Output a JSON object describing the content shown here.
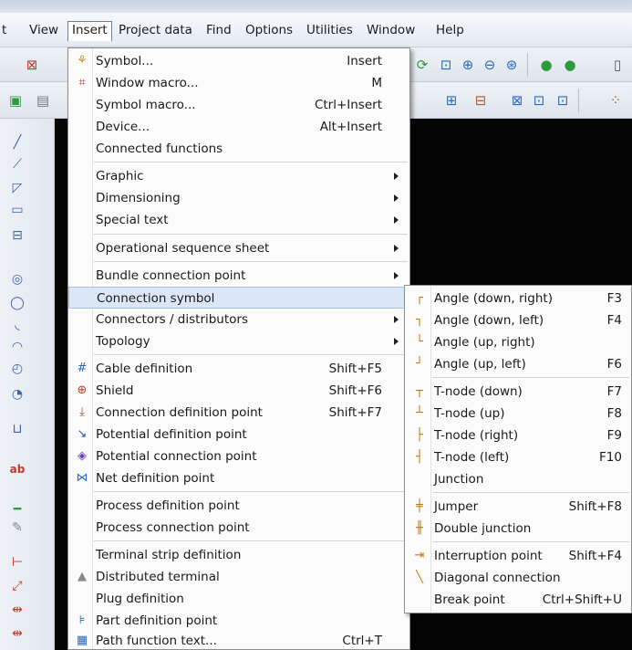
{
  "menubar": {
    "items": [
      "t",
      "View",
      "Insert",
      "Project data",
      "Find",
      "Options",
      "Utilities",
      "Window",
      "Help"
    ]
  },
  "insert_menu": {
    "items": [
      {
        "label": "Symbol...",
        "shortcut": "Insert",
        "icon": "symbol-icon"
      },
      {
        "label": "Window macro...",
        "shortcut": "M",
        "icon": "window-macro-icon"
      },
      {
        "label": "Symbol macro...",
        "shortcut": "Ctrl+Insert"
      },
      {
        "label": "Device...",
        "shortcut": "Alt+Insert"
      },
      {
        "label": "Connected functions"
      },
      {
        "label": "Graphic",
        "submenu": true
      },
      {
        "label": "Dimensioning",
        "submenu": true
      },
      {
        "label": "Special text",
        "submenu": true
      },
      {
        "label": "Operational sequence sheet",
        "submenu": true
      },
      {
        "label": "Bundle connection point",
        "submenu": true
      },
      {
        "label": "Connection symbol",
        "submenu": true,
        "highlighted": true
      },
      {
        "label": "Connectors / distributors",
        "submenu": true
      },
      {
        "label": "Topology",
        "submenu": true
      },
      {
        "label": "Cable definition",
        "shortcut": "Shift+F5",
        "icon": "cable-definition-icon"
      },
      {
        "label": "Shield",
        "shortcut": "Shift+F6",
        "icon": "shield-icon"
      },
      {
        "label": "Connection definition point",
        "shortcut": "Shift+F7",
        "icon": "connection-definition-point-icon"
      },
      {
        "label": "Potential definition point",
        "icon": "potential-definition-point-icon"
      },
      {
        "label": "Potential connection point",
        "icon": "potential-connection-point-icon"
      },
      {
        "label": "Net definition point",
        "icon": "net-definition-point-icon"
      },
      {
        "label": "Process definition point"
      },
      {
        "label": "Process connection point"
      },
      {
        "label": "Terminal strip definition"
      },
      {
        "label": "Distributed terminal",
        "icon": "distributed-terminal-icon"
      },
      {
        "label": "Plug definition"
      },
      {
        "label": "Part definition point",
        "icon": "part-definition-point-icon"
      },
      {
        "label": "Path function text...",
        "shortcut": "Ctrl+T",
        "icon": "path-function-text-icon"
      }
    ]
  },
  "connection_submenu": {
    "items": [
      {
        "label": "Angle (down, right)",
        "shortcut": "F3"
      },
      {
        "label": "Angle (down, left)",
        "shortcut": "F4"
      },
      {
        "label": "Angle (up, right)",
        "shortcut": ""
      },
      {
        "label": "Angle (up, left)",
        "shortcut": "F6"
      },
      {
        "label": "T-node (down)",
        "shortcut": "F7"
      },
      {
        "label": "T-node (up)",
        "shortcut": "F8"
      },
      {
        "label": "T-node (right)",
        "shortcut": "F9"
      },
      {
        "label": "T-node (left)",
        "shortcut": "F10"
      },
      {
        "label": "Junction",
        "shortcut": ""
      },
      {
        "label": "Jumper",
        "shortcut": "Shift+F8"
      },
      {
        "label": "Double junction",
        "shortcut": ""
      },
      {
        "label": "Interruption point",
        "shortcut": "Shift+F4"
      },
      {
        "label": "Diagonal connection",
        "shortcut": ""
      },
      {
        "label": "Break point",
        "shortcut": "Ctrl+Shift+U"
      }
    ]
  },
  "colors": {
    "accent": "#2a6bbf",
    "highlight": "#dbe6f6",
    "canvas": "#050505"
  }
}
